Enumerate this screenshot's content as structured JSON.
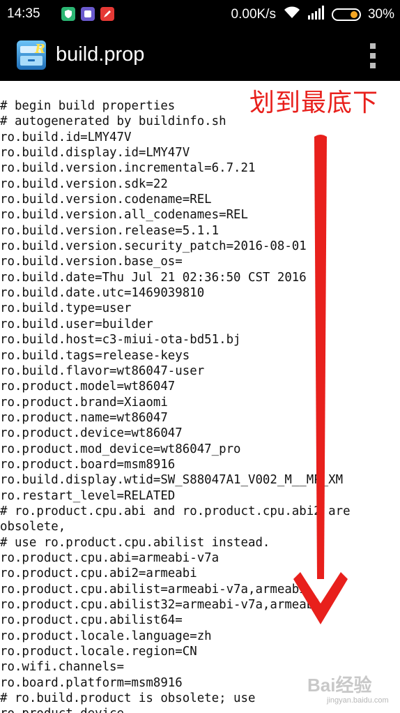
{
  "status_bar": {
    "time": "14:35",
    "network_speed": "0.00K/s",
    "battery_percent": "30%",
    "battery_level": 0.3,
    "icons": [
      "shield-app-icon",
      "notification-app-icon",
      "pen-app-icon",
      "wifi-icon",
      "signal-icon",
      "battery-icon"
    ]
  },
  "toolbar": {
    "title": "build.prop",
    "app_icon": "root-explorer-icon",
    "menu_icon": "overflow-menu-icon"
  },
  "file_lines": [
    "# begin build properties",
    "# autogenerated by buildinfo.sh",
    "ro.build.id=LMY47V",
    "ro.build.display.id=LMY47V",
    "ro.build.version.incremental=6.7.21",
    "ro.build.version.sdk=22",
    "ro.build.version.codename=REL",
    "ro.build.version.all_codenames=REL",
    "ro.build.version.release=5.1.1",
    "ro.build.version.security_patch=2016-08-01",
    "ro.build.version.base_os=",
    "ro.build.date=Thu Jul 21 02:36:50 CST 2016",
    "ro.build.date.utc=1469039810",
    "ro.build.type=user",
    "ro.build.user=builder",
    "ro.build.host=c3-miui-ota-bd51.bj",
    "ro.build.tags=release-keys",
    "ro.build.flavor=wt86047-user",
    "ro.product.model=wt86047",
    "ro.product.brand=Xiaomi",
    "ro.product.name=wt86047",
    "ro.product.device=wt86047",
    "ro.product.mod_device=wt86047_pro",
    "ro.product.board=msm8916",
    "ro.build.display.wtid=SW_S88047A1_V002_M__MP_XM",
    "ro.restart_level=RELATED",
    "# ro.product.cpu.abi and ro.product.cpu.abi2 are",
    "obsolete,",
    "# use ro.product.cpu.abilist instead.",
    "ro.product.cpu.abi=armeabi-v7a",
    "ro.product.cpu.abi2=armeabi",
    "ro.product.cpu.abilist=armeabi-v7a,armeabi",
    "ro.product.cpu.abilist32=armeabi-v7a,armeabi",
    "ro.product.cpu.abilist64=",
    "ro.product.locale.language=zh",
    "ro.product.locale.region=CN",
    "ro.wifi.channels=",
    "ro.board.platform=msm8916",
    "# ro.build.product is obsolete; use",
    "ro.product.device"
  ],
  "annotation": {
    "text": "划到最底下",
    "color": "#e8201c",
    "arrow_direction": "down"
  },
  "watermark": {
    "main": "Bai经验",
    "sub": "jingyan.baidu.com"
  }
}
